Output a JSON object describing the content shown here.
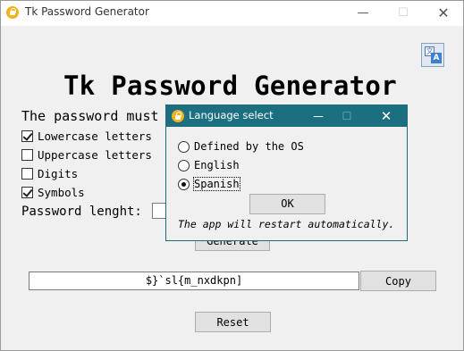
{
  "window": {
    "title": "Tk Password Generator",
    "controls": {
      "minimize": "—",
      "maximize": "☐",
      "close": "✕"
    }
  },
  "language_button": {
    "icon": "language-translate-icon",
    "glyph_a": "文",
    "glyph_b": "A"
  },
  "heading": "Tk Password Generator",
  "options_label": "The password must",
  "options": [
    {
      "label": "Lowercase letters",
      "checked": true
    },
    {
      "label": "Uppercase letters",
      "checked": false
    },
    {
      "label": "Digits",
      "checked": false
    },
    {
      "label": "Symbols",
      "checked": true
    }
  ],
  "length_label": "Password lenght:",
  "length_value": "",
  "generate_label": "Generate",
  "password": "$}`sl{m_nxdkpn]",
  "copy_label": "Copy",
  "reset_label": "Reset",
  "dialog": {
    "title": "Language select",
    "controls": {
      "minimize": "—",
      "maximize": "☐",
      "close": "✕"
    },
    "options": [
      {
        "label": "Defined by the OS",
        "selected": false
      },
      {
        "label": "English",
        "selected": false
      },
      {
        "label": "Spanish",
        "selected": true
      }
    ],
    "ok_label": "OK",
    "note": "The app will restart automatically."
  },
  "colors": {
    "dialog_titlebar": "#1c6f80",
    "window_bg": "#f0f0f0",
    "button_bg": "#e1e1e1",
    "icon_accent": "#f3b21c"
  }
}
